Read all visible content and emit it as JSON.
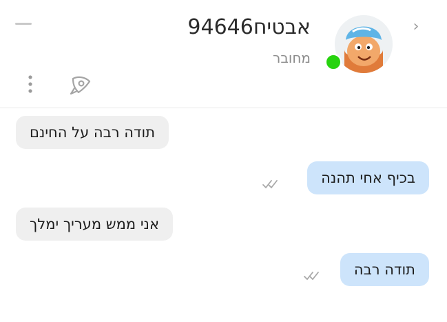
{
  "header": {
    "contact_name": "אבטיח94646",
    "contact_status": "מחובר",
    "status_color": "#27d30f"
  },
  "icons": {
    "minimize": "minimize-icon",
    "back": "chevron-right-icon",
    "more": "more-vertical-icon",
    "rocket": "rocket-icon",
    "read": "double-check-icon"
  },
  "messages": [
    {
      "direction": "incoming",
      "text": "תודה רבה על החינם"
    },
    {
      "direction": "outgoing",
      "text": "בכיף אחי תהנה",
      "status": "read"
    },
    {
      "direction": "incoming",
      "text": "אני ממש מעריך ימלך"
    },
    {
      "direction": "outgoing",
      "text": "תודה רבה",
      "status": "read"
    }
  ],
  "colors": {
    "incoming_bubble": "#efefef",
    "outgoing_bubble": "#cde4fb"
  }
}
